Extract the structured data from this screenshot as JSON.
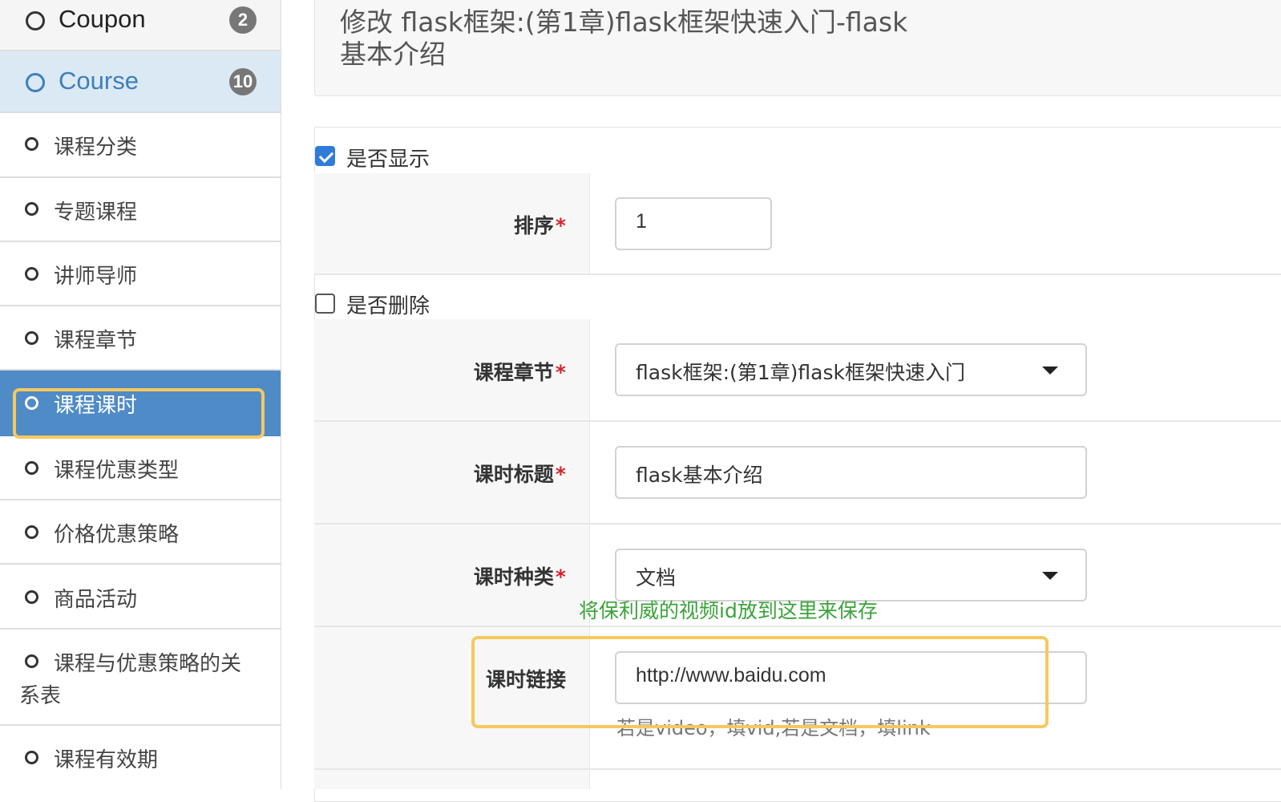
{
  "sidebar": {
    "items": [
      {
        "label": "Coupon",
        "badge": "2"
      },
      {
        "label": "Course",
        "badge": "10"
      },
      {
        "label": "课程分类"
      },
      {
        "label": "专题课程"
      },
      {
        "label": "讲师导师"
      },
      {
        "label": "课程章节"
      },
      {
        "label": "课程课时"
      },
      {
        "label": "课程优惠类型"
      },
      {
        "label": "价格优惠策略"
      },
      {
        "label": "商品活动"
      },
      {
        "label": "课程与优惠策略的关",
        "label_line2": "系表"
      },
      {
        "label": "课程有效期"
      }
    ]
  },
  "header": {
    "title_line1": "修改 flask框架:(第1章)flask框架快速入门-flask",
    "title_line2": "基本介绍"
  },
  "form": {
    "show_checkbox": {
      "label": "是否显示",
      "checked": true
    },
    "order": {
      "label": "排序",
      "required_mark": "*",
      "value": "1"
    },
    "delete_checkbox": {
      "label": "是否删除",
      "checked": false
    },
    "chapter": {
      "label": "课程章节",
      "required_mark": "*",
      "value": "flask框架:(第1章)flask框架快速入门"
    },
    "title": {
      "label": "课时标题",
      "required_mark": "*",
      "value": "flask基本介绍"
    },
    "kind": {
      "label": "课时种类",
      "required_mark": "*",
      "value": "文档"
    },
    "annotation": "将保利威的视频id放到这里来保存",
    "link": {
      "label": "课时链接",
      "value": "http://www.baidu.com",
      "help": "若是video，填vid,若是文档，填link"
    }
  },
  "colors": {
    "active_nav": "#4f8bc6",
    "course_nav": "#dbe9f4",
    "highlight_box": "#f6c85f",
    "annotation_text": "#3aa33a",
    "required_mark": "#d9232d",
    "checkbox_checked": "#2f7bd8"
  }
}
